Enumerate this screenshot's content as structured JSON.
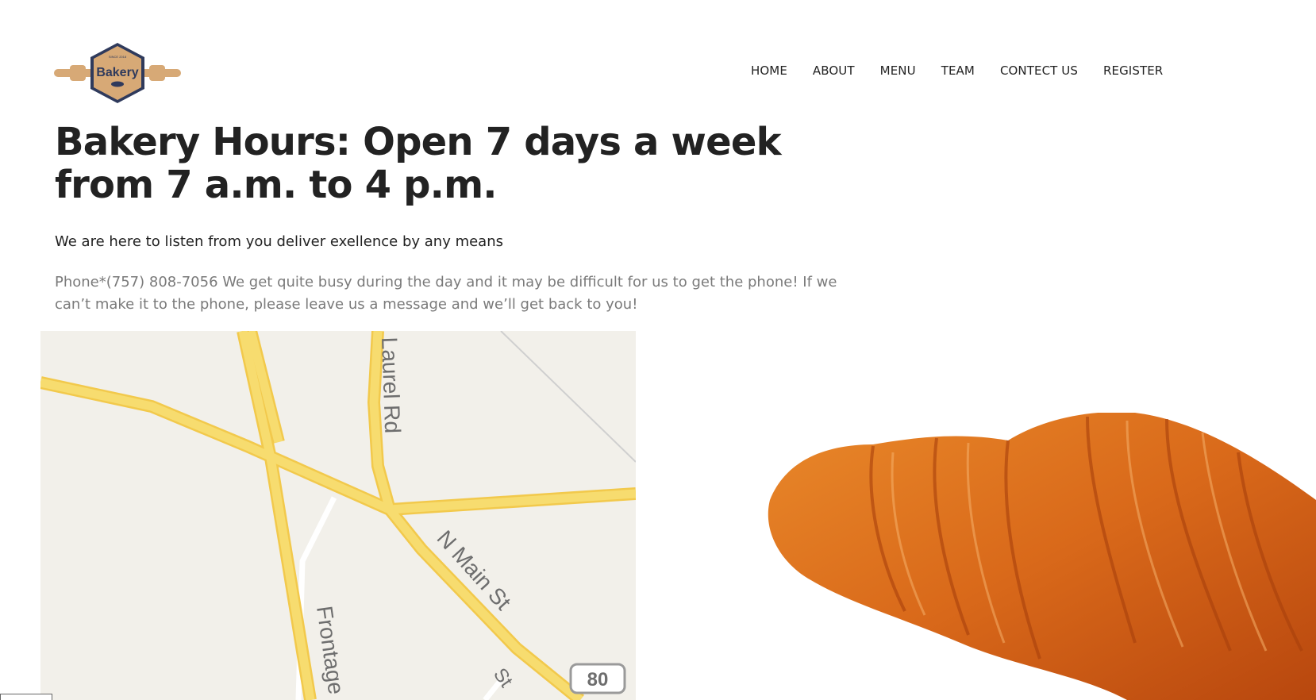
{
  "brand": {
    "logo_text": "Bakery",
    "logo_small_text": "SINCE 2018",
    "colors": {
      "logo_tan": "#d7a976",
      "logo_navy": "#2f3a5c"
    }
  },
  "nav": {
    "items": [
      {
        "label": "HOME"
      },
      {
        "label": "ABOUT"
      },
      {
        "label": "MENU"
      },
      {
        "label": "TEAM"
      },
      {
        "label": "CONTECT US"
      },
      {
        "label": "REGISTER"
      }
    ]
  },
  "main": {
    "headline": "Bakery Hours: Open 7 days a week from 7 a.m. to 4 p.m.",
    "tagline": "We are here to listen from you deliver exellence by any means",
    "info": "Phone*(757) 808-7056 We get quite busy during the day and it may be difficult for us to get the phone! If we can’t make it to the phone, please leave us a message and we’ll get back to you!"
  },
  "map": {
    "labels": {
      "road1": "Laurel Rd",
      "road2": "N Main St",
      "road3": "Frontage",
      "road4": "St",
      "shield": "80"
    },
    "colors": {
      "land": "#f2f0ea",
      "road": "#f7dc6f",
      "road_edge": "#f2c94c"
    }
  },
  "croissant": {
    "icon": "croissant-image"
  }
}
